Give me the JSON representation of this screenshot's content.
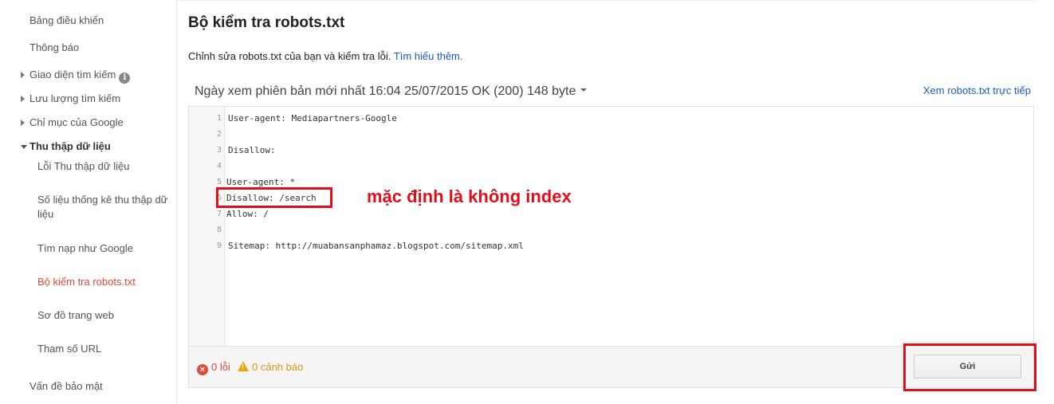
{
  "sidebar": {
    "items": [
      {
        "label": "Bảng điều khiển"
      },
      {
        "label": "Thông báo"
      },
      {
        "label": "Giao diện tìm kiếm"
      },
      {
        "label": "Lưu lượng tìm kiếm"
      },
      {
        "label": "Chỉ mục của Google"
      },
      {
        "label": "Thu thập dữ liệu"
      },
      {
        "label": "Lỗi Thu thập dữ liệu"
      },
      {
        "label": "Số liệu thống kê thu thập dữ liệu"
      },
      {
        "label": "Tìm nạp như Google"
      },
      {
        "label": "Bộ kiểm tra robots.txt"
      },
      {
        "label": "Sơ đồ trang web"
      },
      {
        "label": "Tham số URL"
      },
      {
        "label": "Vấn đề bảo mật"
      }
    ]
  },
  "main": {
    "title": "Bộ kiểm tra robots.txt",
    "subtitle": "Chỉnh sửa robots.txt của bạn và kiểm tra lỗi.",
    "learn_more": "Tìm hiểu thêm.",
    "version_label": "Ngày xem phiên bản mới nhất 16:04 25/07/2015 OK (200) 148 byte",
    "live_link": "Xem robots.txt trực tiếp"
  },
  "editor": {
    "lines": [
      {
        "num": "1",
        "text": "User-agent: Mediapartners-Google"
      },
      {
        "num": "2",
        "text": ""
      },
      {
        "num": "3",
        "text": "Disallow:"
      },
      {
        "num": "4",
        "text": ""
      },
      {
        "num": "5",
        "text": "User-agent: *"
      },
      {
        "num": "6",
        "text": "Disallow: /search"
      },
      {
        "num": "7",
        "text": "Allow: /"
      },
      {
        "num": "8",
        "text": ""
      },
      {
        "num": "9",
        "text": "Sitemap: http://muabansanphamaz.blogspot.com/sitemap.xml"
      }
    ]
  },
  "footer": {
    "errors": "0 lỗi",
    "warnings": "0 cảnh báo",
    "submit_label": "Gửi"
  },
  "annotation": {
    "text": "mặc định là không index"
  },
  "colors": {
    "accent": "#dd4b39",
    "link": "#1a5bc6",
    "annotation": "#e0101a",
    "warning": "#f0a30a"
  }
}
